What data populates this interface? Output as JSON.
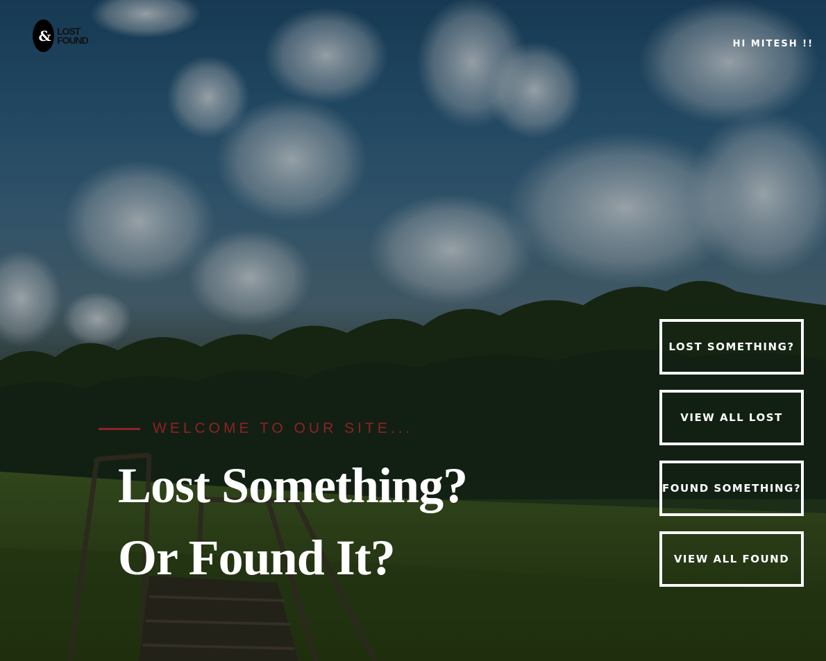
{
  "header": {
    "logo": {
      "mark": "&",
      "line1": "LOST",
      "line2": "FOUND"
    },
    "greeting": "HI MITESH !!"
  },
  "hero": {
    "welcome": "WELCOME TO OUR SITE...",
    "headline_line1": "Lost Something?",
    "headline_line2": "Or Found It?"
  },
  "actions": {
    "lost_something": "LOST SOMETHING?",
    "view_all_lost": "VIEW ALL LOST",
    "found_something": "FOUND SOMETHING?",
    "view_all_found": "VIEW ALL FOUND"
  },
  "colors": {
    "accent": "#8e2226",
    "button_border": "#ffffff"
  }
}
